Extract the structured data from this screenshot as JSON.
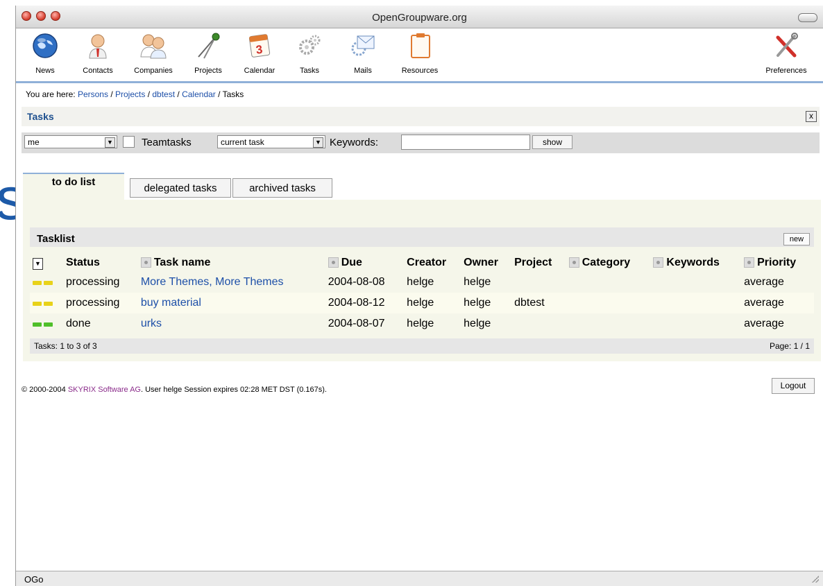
{
  "window": {
    "title": "OpenGroupware.org"
  },
  "bg_fragment": "s",
  "toolbar": {
    "items": [
      {
        "label": "News",
        "icon": "news-globe-icon"
      },
      {
        "label": "Contacts",
        "icon": "contacts-person-icon"
      },
      {
        "label": "Companies",
        "icon": "companies-group-icon"
      },
      {
        "label": "Projects",
        "icon": "projects-compass-icon"
      },
      {
        "label": "Calendar",
        "icon": "calendar-icon"
      },
      {
        "label": "Tasks",
        "icon": "tasks-gears-icon"
      },
      {
        "label": "Mails",
        "icon": "mails-envelope-icon"
      },
      {
        "label": "Resources",
        "icon": "resources-clipboard-icon"
      }
    ],
    "preferences_label": "Preferences"
  },
  "breadcrumb": {
    "prefix": "You are here: ",
    "items": [
      "Persons",
      "Projects",
      "dbtest",
      "Calendar"
    ],
    "current": "Tasks",
    "sep": " / "
  },
  "section": {
    "title": "Tasks",
    "close_label": "x"
  },
  "filter": {
    "owner_value": "me",
    "teamtasks_label": "Teamtasks",
    "teamtasks_checked": false,
    "mode_value": "current task",
    "keywords_label": "Keywords:",
    "keywords_value": "",
    "show_label": "show"
  },
  "tabs": [
    {
      "label": "to do list",
      "active": true
    },
    {
      "label": "delegated tasks",
      "active": false
    },
    {
      "label": "archived tasks",
      "active": false
    }
  ],
  "tasklist": {
    "title": "Tasklist",
    "new_label": "new",
    "columns": [
      "Status",
      "Task name",
      "Due",
      "Creator",
      "Owner",
      "Project",
      "Category",
      "Keywords",
      "Priority"
    ],
    "rows": [
      {
        "status": "processing",
        "name": "More Themes, More Themes",
        "due": "2004-08-08",
        "creator": "helge",
        "owner": "helge",
        "project": "",
        "category": "",
        "keywords": "",
        "priority": "average",
        "status_color": "#e8d21a"
      },
      {
        "status": "processing",
        "name": "buy material",
        "due": "2004-08-12",
        "creator": "helge",
        "owner": "helge",
        "project": "dbtest",
        "category": "",
        "keywords": "",
        "priority": "average",
        "status_color": "#e8d21a"
      },
      {
        "status": "done",
        "name": "urks",
        "due": "2004-08-07",
        "creator": "helge",
        "owner": "helge",
        "project": "",
        "category": "",
        "keywords": "",
        "priority": "average",
        "status_color": "#4fbf2a"
      }
    ],
    "count_text": "Tasks: 1 to 3 of 3",
    "page_text": "Page: 1 / 1"
  },
  "footer": {
    "copyright_prefix": "© 2000-2004 ",
    "company": "SKYRIX Software AG",
    "copyright_suffix": ". User helge Session expires 02:28 MET DST (0.167s).",
    "logout_label": "Logout"
  },
  "statusbar": {
    "text": "OGo"
  }
}
